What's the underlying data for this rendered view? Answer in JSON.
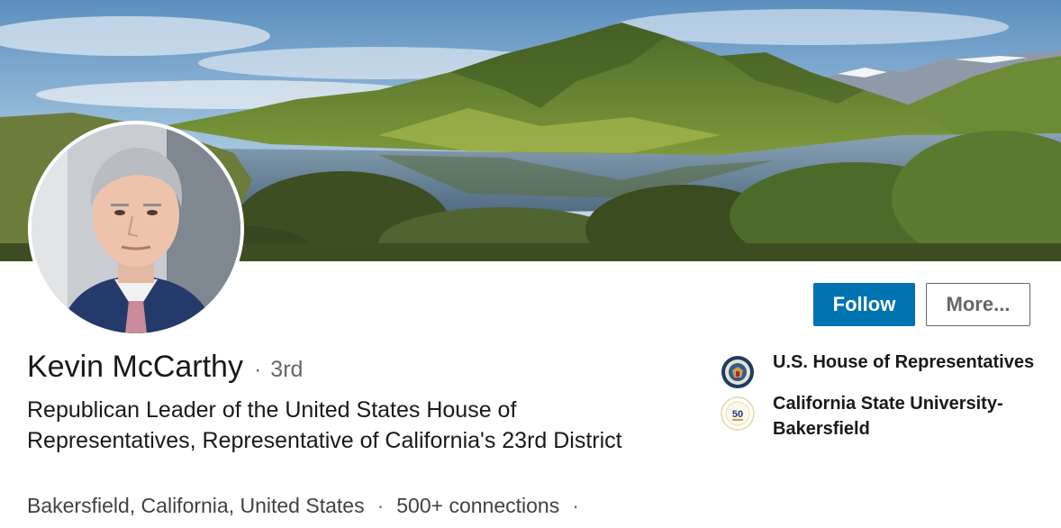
{
  "profile": {
    "name": "Kevin McCarthy",
    "degree_separator": "·",
    "degree": "3rd",
    "headline": "Republican Leader of the United States House of Representatives, Representative of California's 23rd District",
    "location": "Bakersfield, California, United States",
    "location_separator": "·",
    "connections": "500+ connections",
    "trailing_separator": "·"
  },
  "actions": {
    "follow_label": "Follow",
    "more_label": "More..."
  },
  "experience": [
    {
      "name": "U.S. House of Representatives",
      "logo": "house-seal-icon"
    },
    {
      "name": "California State University-Bakersfield",
      "logo": "csub-50-years-icon",
      "logo_text": "50"
    }
  ],
  "colors": {
    "primary_button": "#0073b1",
    "text_primary": "rgba(0,0,0,0.9)",
    "text_secondary": "rgba(0,0,0,0.6)"
  }
}
